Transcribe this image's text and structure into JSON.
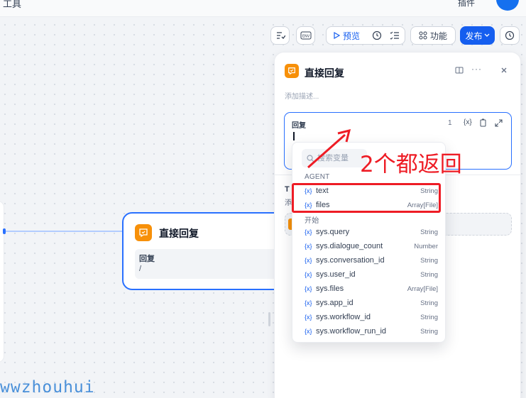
{
  "topbar": {
    "tools_label": "工具",
    "plugin_label": "插件"
  },
  "toolbar": {
    "preview_label": "预览",
    "features_label": "功能",
    "publish_label": "发布"
  },
  "canvas": {
    "node": {
      "title": "直接回复",
      "field_label": "回复",
      "field_value": "/"
    }
  },
  "panel": {
    "title": "直接回复",
    "description_placeholder": "添加描述...",
    "editor_label": "回复",
    "editor_count": "1",
    "var_icon": "{x}",
    "section_title": "T",
    "section_text": "添"
  },
  "dropdown": {
    "search_placeholder": "搜索变量",
    "groups": [
      {
        "name": "AGENT",
        "items": [
          {
            "name": "text",
            "type": "String"
          },
          {
            "name": "files",
            "type": "Array[File]"
          }
        ]
      },
      {
        "name": "开始",
        "items": [
          {
            "name": "sys.query",
            "type": "String"
          },
          {
            "name": "sys.dialogue_count",
            "type": "Number"
          },
          {
            "name": "sys.conversation_id",
            "type": "String"
          },
          {
            "name": "sys.user_id",
            "type": "String"
          },
          {
            "name": "sys.files",
            "type": "Array[File]"
          },
          {
            "name": "sys.app_id",
            "type": "String"
          },
          {
            "name": "sys.workflow_id",
            "type": "String"
          },
          {
            "name": "sys.workflow_run_id",
            "type": "String"
          }
        ]
      }
    ]
  },
  "annotation": {
    "text": "2个都返回"
  },
  "watermark": "wwzhouhui",
  "colors": {
    "accent": "#155eef",
    "node_icon": "#f79009",
    "annotation": "#ee1c25"
  }
}
